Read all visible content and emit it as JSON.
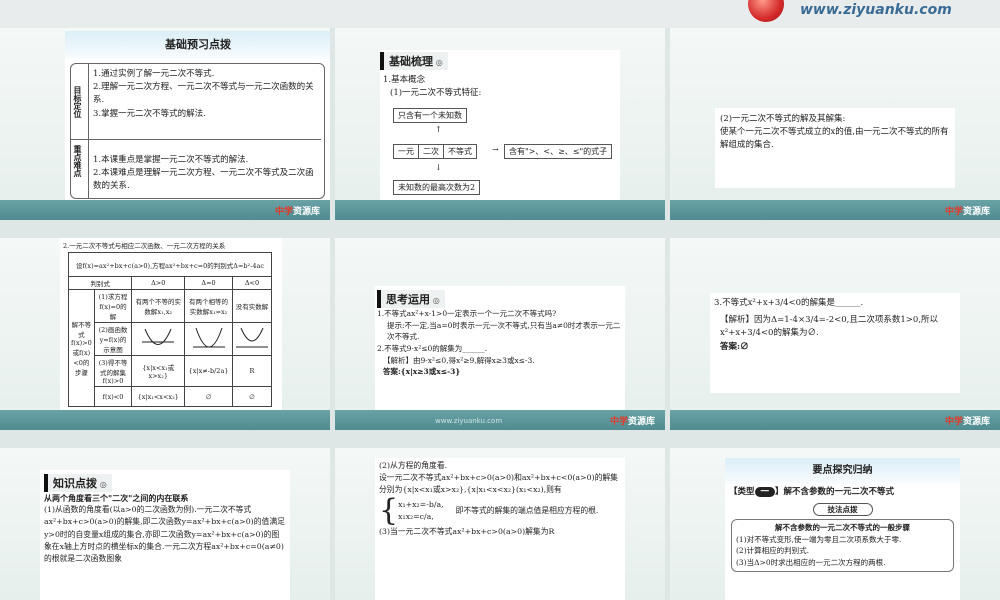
{
  "header": {
    "site_url": "www.ziyuanku.com"
  },
  "brand": {
    "name": "中学",
    "sub": "资源库"
  },
  "tile1": {
    "title": "基础预习点拨",
    "objectives_label": "目标定位",
    "objectives": [
      "1.通过实例了解一元二次不等式.",
      "2.理解一元二次方程、一元二次不等式与一元二次函数的关系.",
      "3.掌握一元二次不等式的解法."
    ],
    "key_label": "重点难点",
    "key": [
      "1.本课重点是掌握一元二次不等式的解法.",
      "2.本课难点是理解一元二次方程、一元二次不等式及二次函数的关系."
    ]
  },
  "tile2": {
    "heading": "基础梳理",
    "section": "1.基本概念",
    "sub": "(1)一元二次不等式特征:",
    "box_top": "只含有一个未知数",
    "box_items": [
      "一元",
      "二次",
      "不等式"
    ],
    "box_right": "含有\">、<、≥、≤\"的式子",
    "box_bottom": "未知数的最高次数为2"
  },
  "tile3": {
    "title": "(2)一元二次不等式的解及其解集:",
    "body": "使某个一元二次不等式成立的x的值,由一元二次不等式的所有解组成的集合."
  },
  "tile4": {
    "caption": "2.一元二次不等式与相应二次函数、一元二次方程的关系",
    "row_setup": "设f(x)=ax²+bx+c(a>0),方程ax²+bx+c=0的判别式Δ=b²-4ac",
    "cols": [
      "判别式",
      "Δ>0",
      "Δ=0",
      "Δ<0"
    ],
    "rows": [
      {
        "label": "(1)求方程f(x)=0的解",
        "cells": [
          "有两个不等的实数解x₁,x₂",
          "有两个相等的实数解x₁=x₂",
          "没有实数解"
        ]
      },
      {
        "label": "(2)画函数y=f(x)的示意图",
        "cells": [
          "",
          "",
          ""
        ]
      },
      {
        "label": "f(x)>0",
        "cells": [
          "{x|x<x₁或x>x₂}",
          "{x|x≠-b/2a}",
          "R"
        ]
      },
      {
        "label": "f(x)<0",
        "cells": [
          "{x|x₁<x<x₂}",
          "∅",
          "∅"
        ]
      }
    ],
    "side_label": "解不等式f(x)>0或f(x)<0的步骤",
    "solution_label": "(3)得不等式的解集"
  },
  "tile5": {
    "heading": "思考运用",
    "q1": "1.不等式ax²+x-1>0一定表示一个一元二次不等式吗?",
    "a1": "提示:不一定,当a=0时表示一元一次不等式,只有当a≠0时才表示一元二次不等式.",
    "q2": "2.不等式9-x²≤0的解集为______.",
    "a2": "【解析】由9-x²≤0,得x²≥9,解得x≥3或x≤-3.",
    "ans2": "答案:{x|x≥3或x≤-3}"
  },
  "tile6": {
    "q": "3.不等式x²+x+3/4<0的解集是______.",
    "a": "【解析】因为Δ=1-4×3/4=-2<0,且二次项系数1>0,所以x²+x+3/4<0的解集为∅.",
    "ans": "答案:∅"
  },
  "tile7": {
    "heading": "知识点拨",
    "title": "从两个角度看三个\"二次\"之间的内在联系",
    "body": "(1)从函数的角度看(以a>0的二次函数为例).一元二次不等式ax²+bx+c>0(a>0)的解集,即二次函数y=ax²+bx+c(a>0)的值满足y>0时的自变量x组成的集合,亦即二次函数y=ax²+bx+c(a>0)的图象在x轴上方时点的横坐标x的集合.一元二次方程ax²+bx+c=0(a≠0)的根就是二次函数图象"
  },
  "tile8": {
    "p1": "(2)从方程的角度看.",
    "p2": "设一元二次不等式ax²+bx+c>0(a>0)和ax²+bx+c<0(a>0)的解集分别为{x|x<x₁或x>x₂},{x|x₁<x<x₂}(x₁<x₂),则有",
    "sys1": "x₁+x₂=-b/a,",
    "sys2": "x₁x₂=c/a,",
    "p3": "即不等式的解集的端点值是相应方程的根.",
    "p4": "(3)当一元二次不等式ax²+bx+c>0(a>0)解集为R"
  },
  "tile9": {
    "title": "要点探究归纳",
    "type_label": "【类型",
    "type_num": "一",
    "type_text": "】解不含参数的一元二次不等式",
    "method": "技法点拨",
    "subhead": "解不含参数的一元二次不等式的一般步骤",
    "steps": [
      "(1)对不等式变形,使一端为零且二次项系数大于零.",
      "(2)计算相应的判别式.",
      "(3)当Δ>0时求出相应的一元二次方程的两根."
    ]
  }
}
